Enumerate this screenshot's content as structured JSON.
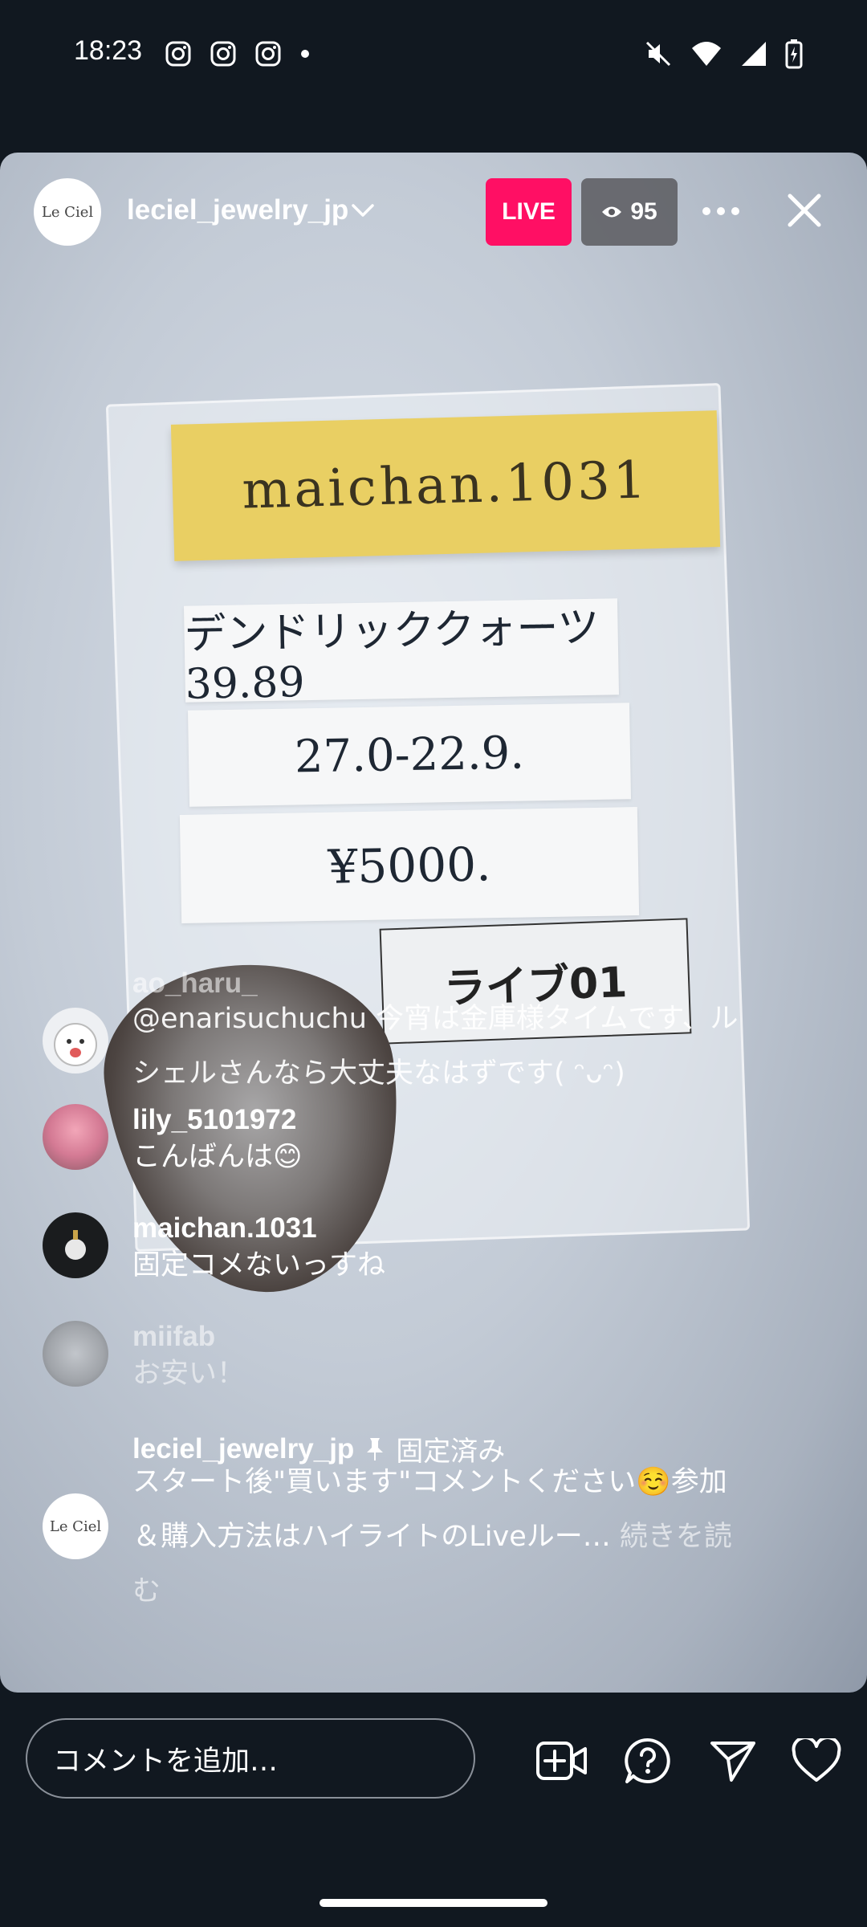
{
  "status_bar": {
    "time": "18:23",
    "app_icons": [
      "instagram-icon",
      "instagram-icon",
      "instagram-icon",
      "dot-icon"
    ],
    "right_icons": [
      "mute-icon",
      "wifi-icon",
      "signal-icon",
      "battery-charging-icon"
    ]
  },
  "live": {
    "host_avatar_text": "Le Ciel",
    "host_name": "leciel_jewelry_jp",
    "live_label": "LIVE",
    "viewer_count": "95"
  },
  "video": {
    "sticky_note": "maichan.1031",
    "paper_1": "デンドリッククォーツ 39.89",
    "paper_2": "27.0-22.9.",
    "paper_3": "¥5000.",
    "label_tag": "ライブ01"
  },
  "comments": [
    {
      "user": "ao_haru_",
      "text": "@enarisuchuchu 今宵は金庫様タイムです、ルシェルさんなら大丈夫なはずです( ᵔᴗᵔ)"
    },
    {
      "user": "lily_5101972",
      "text": "こんばんは😊"
    },
    {
      "user": "maichan.1031",
      "text": "固定コメないっすね"
    },
    {
      "user": "miifab",
      "text": "お安い！"
    }
  ],
  "pinned": {
    "avatar_text": "Le Ciel",
    "user": "leciel_jewelry_jp",
    "pin_label": "固定済み",
    "text": "スタート後\"買います\"コメントください☺️参加＆購入方法はハイライトのLiveルー…",
    "more_label": "続きを読む"
  },
  "bottom_bar": {
    "comment_placeholder": "コメントを追加…"
  },
  "colors": {
    "live_badge": "#ff0f64",
    "background": "#111820"
  }
}
